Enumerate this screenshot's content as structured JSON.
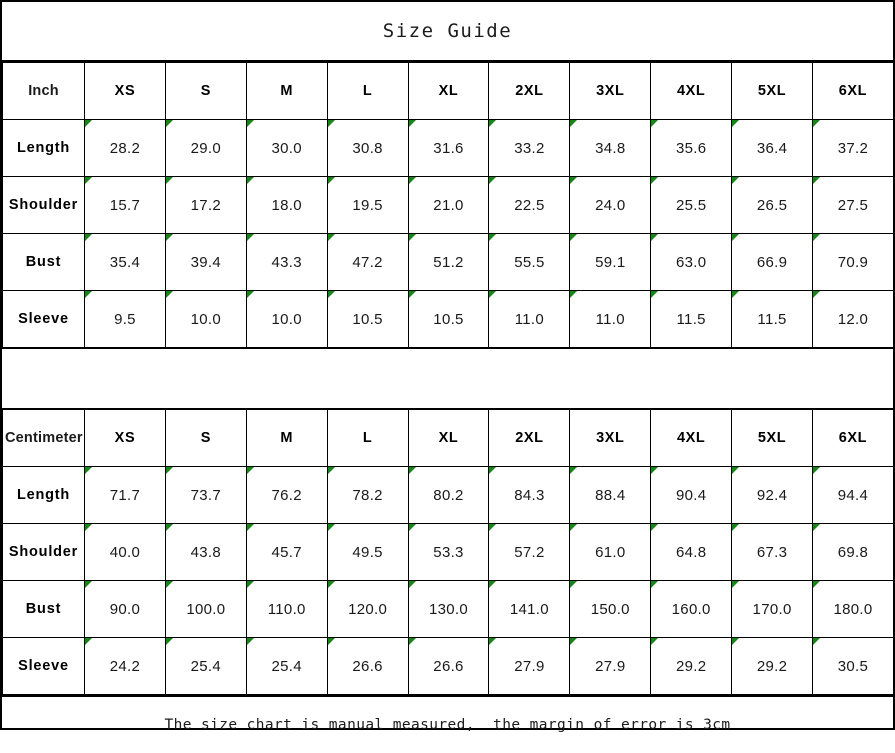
{
  "title": "Size Guide",
  "footer_note": "The size chart is manual measured,  the margin of error is 3cm",
  "marker": {
    "icon": "green-corner-triangle",
    "color": "#168616"
  },
  "sizes": [
    "XS",
    "S",
    "M",
    "L",
    "XL",
    "2XL",
    "3XL",
    "4XL",
    "5XL",
    "6XL"
  ],
  "tables": [
    {
      "unit_label": "Inch",
      "unit": "inch",
      "rows": [
        {
          "measure": "Length",
          "values": [
            "28.2",
            "29.0",
            "30.0",
            "30.8",
            "31.6",
            "33.2",
            "34.8",
            "35.6",
            "36.4",
            "37.2"
          ]
        },
        {
          "measure": "Shoulder",
          "values": [
            "15.7",
            "17.2",
            "18.0",
            "19.5",
            "21.0",
            "22.5",
            "24.0",
            "25.5",
            "26.5",
            "27.5"
          ]
        },
        {
          "measure": "Bust",
          "values": [
            "35.4",
            "39.4",
            "43.3",
            "47.2",
            "51.2",
            "55.5",
            "59.1",
            "63.0",
            "66.9",
            "70.9"
          ]
        },
        {
          "measure": "Sleeve",
          "values": [
            "9.5",
            "10.0",
            "10.0",
            "10.5",
            "10.5",
            "11.0",
            "11.0",
            "11.5",
            "11.5",
            "12.0"
          ]
        }
      ]
    },
    {
      "unit_label": "Centimeter",
      "unit": "cm",
      "rows": [
        {
          "measure": "Length",
          "values": [
            "71.7",
            "73.7",
            "76.2",
            "78.2",
            "80.2",
            "84.3",
            "88.4",
            "90.4",
            "92.4",
            "94.4"
          ]
        },
        {
          "measure": "Shoulder",
          "values": [
            "40.0",
            "43.8",
            "45.7",
            "49.5",
            "53.3",
            "57.2",
            "61.0",
            "64.8",
            "67.3",
            "69.8"
          ]
        },
        {
          "measure": "Bust",
          "values": [
            "90.0",
            "100.0",
            "110.0",
            "120.0",
            "130.0",
            "141.0",
            "150.0",
            "160.0",
            "170.0",
            "180.0"
          ]
        },
        {
          "measure": "Sleeve",
          "values": [
            "24.2",
            "25.4",
            "25.4",
            "26.6",
            "26.6",
            "27.9",
            "27.9",
            "29.2",
            "29.2",
            "30.5"
          ]
        }
      ]
    }
  ]
}
